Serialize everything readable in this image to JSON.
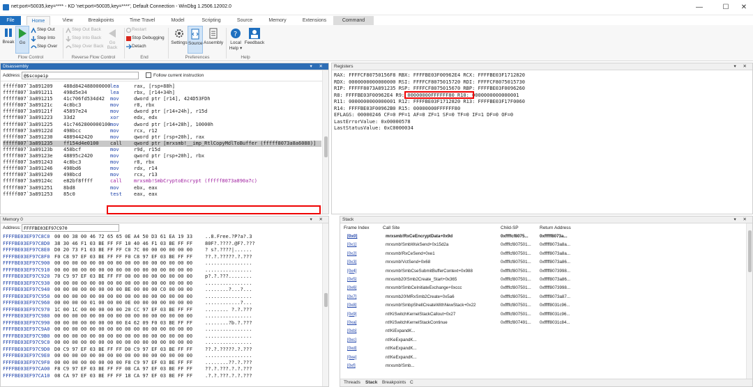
{
  "window": {
    "title": "net:port=50035,key=**** - KD 'net:port=50035,key=****', Default Connection - WinDbg 1.2506.12002.0",
    "controls": [
      "—",
      "☐",
      "✕"
    ]
  },
  "tabs": [
    "File",
    "Home",
    "View",
    "Breakpoints",
    "Time Travel",
    "Model",
    "Scripting",
    "Source",
    "Memory",
    "Extensions",
    "Command"
  ],
  "ribbon": {
    "break": "Break",
    "go": "Go",
    "step_out": "Step Out",
    "step_into": "Step Into",
    "step_over": "Step Over",
    "step_out_back": "Step Out Back",
    "step_into_back": "Step Into Back",
    "step_over_back": "Step Over Back",
    "go_back": "Go",
    "go_back2": "Back",
    "restart": "Restart",
    "stop_debugging": "Stop Debugging",
    "detach": "Detach",
    "settings": "Settings",
    "source": "Source",
    "assembly": "Assembly",
    "local_help": "Local",
    "local_help2": "Help ▾",
    "feedback": "Feedback",
    "groups": [
      "Flow Control",
      "Reverse Flow Control",
      "End",
      "Preferences",
      "Help"
    ]
  },
  "disassembly": {
    "title": "Disassembly",
    "address_label": "Address:",
    "address_value": "@$scopeip",
    "follow_label": "Follow current instruction",
    "lines": [
      {
        "addr": "fffff807`3a891209",
        "bytes": "488d842488000000",
        "mn": "lea",
        "op": "rax, [rsp+88h]"
      },
      {
        "addr": "fffff807`3a891211",
        "bytes": "498d5e34",
        "mn": "lea",
        "op": "rbx, [r14+34h]"
      },
      {
        "addr": "fffff807`3a891215",
        "bytes": "41c706fd534d42",
        "mn": "mov",
        "op": "dword ptr [r14], 424D53FDh"
      },
      {
        "addr": "fffff807`3a89121c",
        "bytes": "4c8bc3",
        "mn": "mov",
        "op": "r8, rbx"
      },
      {
        "addr": "fffff807`3a89121f",
        "bytes": "45897e24",
        "mn": "mov",
        "op": "dword ptr [r14+24h], r15d"
      },
      {
        "addr": "fffff807`3a891223",
        "bytes": "33d2",
        "mn": "xor",
        "op": "edx, edx"
      },
      {
        "addr": "fffff807`3a891225",
        "bytes": "41c7462800000100",
        "mn": "mov",
        "op": "dword ptr [r14+28h], 10000h"
      },
      {
        "addr": "fffff807`3a89122d",
        "bytes": "498bcc",
        "mn": "mov",
        "op": "rcx, r12"
      },
      {
        "addr": "fffff807`3a891230",
        "bytes": "4889442420",
        "mn": "mov",
        "op": "qword ptr [rsp+20h], rax"
      },
      {
        "addr": "fffff807`3a891235",
        "bytes": "ff154d4e0100",
        "mn": "call",
        "op": "qword ptr [mrxsmb!__imp_RtlCopyMdlToBuffer (fffff8073a8a6088)]"
      },
      {
        "addr": "fffff807`3a89123b",
        "bytes": "458bcf",
        "mn": "mov",
        "op": "r9d, r15d"
      },
      {
        "addr": "fffff807`3a89123e",
        "bytes": "48895c2420",
        "mn": "mov",
        "op": "qword ptr [rsp+20h], rbx"
      },
      {
        "addr": "fffff807`3a891243",
        "bytes": "4c8bc3",
        "mn": "mov",
        "op": "r8, rbx"
      },
      {
        "addr": "fffff807`3a891246",
        "bytes": "498bd6",
        "mn": "mov",
        "op": "rdx, r14"
      },
      {
        "addr": "fffff807`3a891249",
        "bytes": "498bcd",
        "mn": "mov",
        "op": "rcx, r13"
      },
      {
        "addr": "fffff807`3a89124c",
        "bytes": "e82bf8ffff",
        "mn": "call",
        "op": "mrxsmb!SmbCryptoEncrypt (fffff8073a890a7c)"
      },
      {
        "addr": "fffff807`3a891251",
        "bytes": "8bd8",
        "mn": "mov",
        "op": "ebx, eax"
      },
      {
        "addr": "fffff807`3a891253",
        "bytes": "85c0",
        "mn": "test",
        "op": "eax, eax"
      }
    ]
  },
  "registers": {
    "title": "Registers",
    "rows": [
      "RAX: FFFFCF80750156F8   RBX: FFFFBE03F00962E4   RCX: FFFFBE03F1712820",
      "RDX: 0000000000000000   RSI: FFFFCF8075015720   RDI: FFFFCF8075015730",
      "RIP: FFFFF8073A891235   RSP: FFFFCF8075015670   RBP: FFFFBE03F0096260",
      "R8:  FFFFBE03F00962E4   R9:  00000000FFFFFF80   R10: 0000000000000001",
      "R11: 0000000000000001   R12: FFFFBE03F1712820   R13: FFFFBE03F17F0060",
      "R14: FFFFBE03F00962B0   R15: 00000000FFFFFF80",
      "EFLAGS: 00000246 CF=0 PF=1 AF=0 ZF=1 SF=0 TF=0 IF=1 DF=0 OF=0",
      "LastErrorValue: 0x00000578",
      "LastStatusValue: 0xC0000034"
    ]
  },
  "memory": {
    "title": "Memory 0",
    "address_label": "Address:",
    "address_value": "FFFFBE03EF97C970",
    "lines": [
      [
        "FFFFBE03EF97C8C0",
        "00 00 38 00 46 72 65 65 0E A4 50 D3 61 EA 19 33",
        "..8.Free.?P?a?.3"
      ],
      [
        "FFFFBE03EF97C8D0",
        "38 30 46 F1 03 BE FF FF 10 40 46 F1 03 BE FF FF",
        "80F?.????.@F?.???"
      ],
      [
        "FFFFBE03EF97C8E0",
        "D0 20 73 F1 03 BE FF FF C0 7C 00 00 00 00 00 00",
        "? s?.????|......"
      ],
      [
        "FFFFBE03EF97C8F0",
        "F0 C8 97 EF 03 BE FF FF F0 C8 97 EF 03 BE FF FF",
        "??.?.?????.?.???"
      ],
      [
        "FFFFBE03EF97C900",
        "00 00 00 00 00 00 00 00 00 00 00 00 00 00 00 00",
        "................"
      ],
      [
        "FFFFBE03EF97C910",
        "00 00 00 00 00 00 00 00 00 00 00 00 00 00 00 00",
        "................"
      ],
      [
        "FFFFBE03EF97C920",
        "70 C9 97 EF 03 BE FF FF 00 00 00 00 00 00 00 00",
        "p?.?.???........"
      ],
      [
        "FFFFBE03EF97C930",
        "00 00 00 00 00 00 00 00 00 00 00 00 00 00 00 00",
        "................"
      ],
      [
        "FFFFBE03EF97C940",
        "00 00 00 00 00 00 00 00 BE 00 00 00 C0 00 00 00",
        "........?...?..."
      ],
      [
        "FFFFBE03EF97C950",
        "00 00 00 00 00 00 00 00 00 00 00 00 00 00 00 00",
        "................"
      ],
      [
        "FFFFBE03EF97C960",
        "00 00 00 00 01 00 00 00 0E 00 00 00 00 00 00 00",
        "............?..."
      ],
      [
        "FFFFBE03EF97C970",
        "1C 00 1C 00 00 00 00 00 20 CC 97 EF 03 BE FF FF",
        "........ ?.?.???"
      ],
      [
        "FFFFBE03EF97C980",
        "00 00 00 00 00 00 00 00 00 00 00 00 00 00 00 00",
        "................"
      ],
      [
        "FFFFBE03EF97C990",
        "00 00 00 00 00 00 00 00 E4 62 09 F0 03 BE FF FF",
        "........?b.?.???"
      ],
      [
        "FFFFBE03EF97C9A0",
        "00 00 00 00 00 00 00 00 00 00 00 00 00 00 00 00",
        "................"
      ],
      [
        "FFFFBE03EF97C9B0",
        "00 00 00 00 00 00 00 00 00 00 00 00 00 00 00 00",
        "................"
      ],
      [
        "FFFFBE03EF97C9C0",
        "00 00 00 00 00 00 00 00 00 00 00 00 00 00 00 00",
        "................"
      ],
      [
        "FFFFBE03EF97C9D0",
        "D0 C9 97 EF 03 BE FF FF D0 C9 97 EF 03 BE FF FF",
        "??.?.?????.?.???"
      ],
      [
        "FFFFBE03EF97C9E0",
        "00 00 00 00 00 00 00 00 00 00 00 00 00 00 00 00",
        "................"
      ],
      [
        "FFFFBE03EF97C9F0",
        "00 00 00 00 00 00 00 00 F8 C9 97 EF 03 BE FF FF",
        "........??.?.???"
      ],
      [
        "FFFFBE03EF97CA00",
        "F8 C9 97 EF 03 BE FF FF 08 CA 97 EF 03 BE FF FF",
        "??.?.???.?.?.???"
      ],
      [
        "FFFFBE03EF97CA10",
        "08 CA 97 EF 03 BE FF FF 18 CA 97 EF 03 BE FF FF",
        ".?.?.???.?.?.???"
      ]
    ]
  },
  "stack": {
    "title": "Stack",
    "headers": [
      "Frame Index",
      "Call Site",
      "Child-SP",
      "Return Address"
    ],
    "rows": [
      [
        "[0x0]",
        "mrxsmb!RxCeEncryptData+0x9d",
        "0xffffcf8075...",
        "0xfffff8073a..."
      ],
      [
        "[0x1]",
        "mrxsmb!SmbWskSend+0x15d2a",
        "0xffffcf807501...",
        "0xfffff8073a8a..."
      ],
      [
        "[0x2]",
        "mrxsmb!RxCeSend+0xe1",
        "0xffffcf807501...",
        "0xfffff8073a8a..."
      ],
      [
        "[0x3]",
        "mrxsmb!VctSend+0x68",
        "0xffffcf807501...",
        "0xfffff8073a86..."
      ],
      [
        "[0x4]",
        "mrxsmb!SmbCseSubmitBufferContext+0x988",
        "0xffffcf807501...",
        "0xfffff8073998..."
      ],
      [
        "[0x5]",
        "mrxsmb20!Smb2Create_Start+0x365",
        "0xffffcf807501...",
        "0xfffff8073a86..."
      ],
      [
        "[0x6]",
        "mrxsmb!SmbCeInitiateExchange+0xccc",
        "0xffffcf807501...",
        "0xfffff8073998..."
      ],
      [
        "[0x7]",
        "mrxsmb20!MRxSmb2Create+0x5a6",
        "0xffffcf807501...",
        "0xfffff8073a87..."
      ],
      [
        "[0x8]",
        "mrxsmb!SmbpShellCreateWithNewStack+0x22",
        "0xffffcf807501...",
        "0xfffff8031c96..."
      ],
      [
        "[0x9]",
        "nt!KiSwitchKernelStackCallout+0x27",
        "0xffffcf807501...",
        "0xfffff8031c96..."
      ],
      [
        "[0xa]",
        "nt!KiSwitchKernelStackContinue",
        "0xffffcf807491...",
        "0xfffff8031c84..."
      ],
      [
        "[0xb]",
        "nt!KiExpandK...",
        "",
        ""
      ],
      [
        "[0xc]",
        "nt!KeExpandK...",
        "",
        ""
      ],
      [
        "[0xd]",
        "nt!KeExpandK...",
        "",
        ""
      ],
      [
        "[0xe]",
        "nt!KeExpandK...",
        "",
        ""
      ],
      [
        "[0xf]",
        "mrxsmb!Smb...",
        "",
        ""
      ]
    ],
    "bottom_tabs": [
      "Threads",
      "Stack",
      "Breakpoints",
      "C"
    ]
  }
}
